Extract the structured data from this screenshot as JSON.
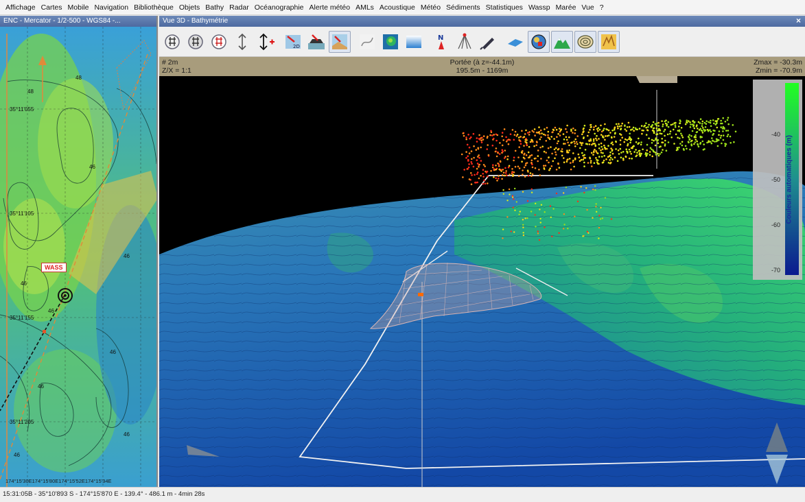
{
  "menu": {
    "items": [
      "Affichage",
      "Cartes",
      "Mobile",
      "Navigation",
      "Bibliothèque",
      "Objets",
      "Bathy",
      "Radar",
      "Océanographie",
      "Alerte météo",
      "AMLs",
      "Acoustique",
      "Météo",
      "Sédiments",
      "Statistiques",
      "Wassp",
      "Marée",
      "Vue",
      "?"
    ]
  },
  "map_panel": {
    "title": "ENC - Mercator - 1/2-500 - WGS84 -...",
    "wass_label": "WASS",
    "bottom_coords": "174°15'30E174°15'80E174°15'52E174°15'34E",
    "lat_labels": [
      "35°11'055",
      "35°11'105",
      "35°11'155",
      "35°11'205"
    ],
    "depth_labels": [
      "48",
      "46",
      "46",
      "46",
      "46",
      "46",
      "46",
      "46",
      "48",
      "46"
    ]
  },
  "view3d": {
    "title": "Vue 3D - Bathymétrie",
    "close_glyph": "×",
    "toolbar_icons": [
      "grid-hash-icon",
      "grid-hash-alt-icon",
      "grid-hash-red-icon",
      "vertical-arrows-icon",
      "vertical-add-icon",
      "view-2d-icon",
      "ship-view-icon",
      "seabed-view-icon",
      "grayscale-map-icon",
      "color-relief-icon",
      "gradient-icon",
      "north-arrow-icon",
      "sonar-beam-icon",
      "pen-tool-icon",
      "water-surface-icon",
      "globe-cube-icon",
      "terrain-icon",
      "contour-icon",
      "texture-icon"
    ],
    "info": {
      "left_line1": "# 2m",
      "left_line2": "Z/X = 1:1",
      "center_line1": "Portée (à z=-44.1m)",
      "center_line2": "195.5m - 1169m",
      "right_line1": "Zmax = -30.3m",
      "right_line2": "Zmin = -70.9m"
    },
    "color_scale": {
      "title": "Couleurs automatiques (m)",
      "ticks": [
        "-40",
        "-50",
        "-60",
        "-70"
      ],
      "color_top": "#22ff22",
      "color_mid": "#1f8f8f",
      "color_bottom": "#0a1a8f"
    }
  },
  "statusbar": {
    "text": "15:31:05B  -  35°10'893 S - 174°15'870 E  -  139.4°  -  486.1 m  -  4min 28s"
  }
}
